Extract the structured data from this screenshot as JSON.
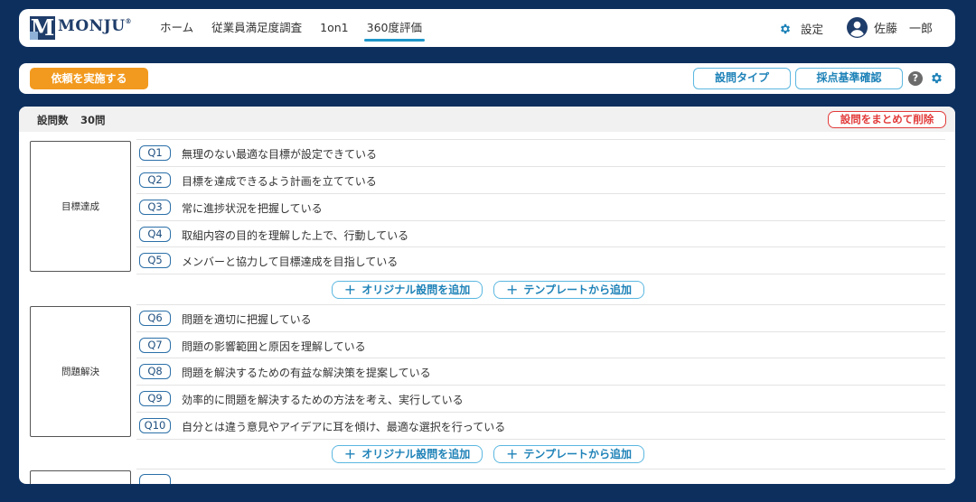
{
  "header": {
    "logo": {
      "mark": "M",
      "text": "MONJU",
      "reg": "®"
    },
    "nav": [
      {
        "label": "ホーム",
        "active": false
      },
      {
        "label": "従業員満足度調査",
        "active": false
      },
      {
        "label": "1on1",
        "active": false
      },
      {
        "label": "360度評価",
        "active": true
      }
    ],
    "settings_label": "設定",
    "user_name": "佐藤　一郎"
  },
  "actionbar": {
    "request_label": "依頼を実施する",
    "question_type_label": "設問タイプ",
    "criteria_label": "採点基準確認",
    "help_glyph": "?"
  },
  "panel": {
    "count_label": "設問数",
    "count_value": "30問",
    "delete_label": "設問をまとめて削除",
    "add_original_label": "オリジナル設問を追加",
    "add_template_label": "テンプレートから追加",
    "categories": [
      {
        "name": "目標達成",
        "questions": [
          {
            "no": "Q1",
            "text": "無理のない最適な目標が設定できている"
          },
          {
            "no": "Q2",
            "text": "目標を達成できるよう計画を立てている"
          },
          {
            "no": "Q3",
            "text": "常に進捗状況を把握している"
          },
          {
            "no": "Q4",
            "text": "取組内容の目的を理解した上で、行動している"
          },
          {
            "no": "Q5",
            "text": "メンバーと協力して目標達成を目指している"
          }
        ]
      },
      {
        "name": "問題解決",
        "questions": [
          {
            "no": "Q6",
            "text": "問題を適切に把握している"
          },
          {
            "no": "Q7",
            "text": "問題の影響範囲と原因を理解している"
          },
          {
            "no": "Q8",
            "text": "問題を解決するための有益な解決策を提案している"
          },
          {
            "no": "Q9",
            "text": "効率的に問題を解決するための方法を考え、実行している"
          },
          {
            "no": "Q10",
            "text": "自分とは違う意見やアイデアに耳を傾け、最適な選択を行っている"
          }
        ]
      }
    ]
  },
  "colors": {
    "background": "#0c2f5e",
    "accent_orange": "#f29a1f",
    "accent_blue": "#1e96c8",
    "danger": "#e23b3b"
  }
}
